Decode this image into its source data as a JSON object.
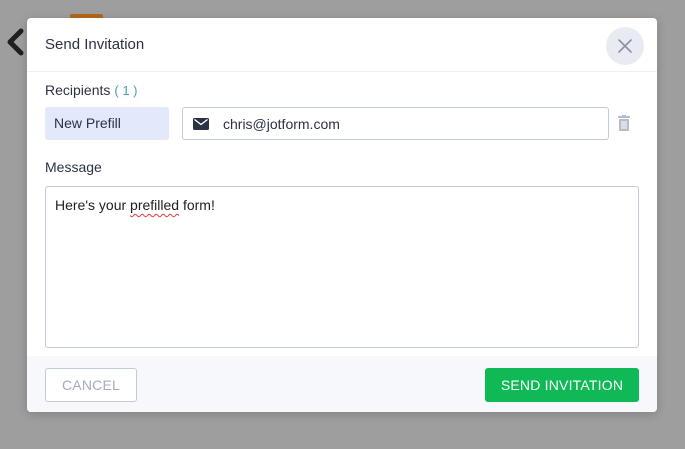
{
  "dialog": {
    "title": "Send Invitation"
  },
  "recipients": {
    "label": "Recipients",
    "count": "( 1 )",
    "items": [
      {
        "name": "New Prefill",
        "email": "chris@jotform.com"
      }
    ]
  },
  "message": {
    "label": "Message",
    "text_before": "Here's your ",
    "misspelled_word": "prefilled",
    "text_after": " form!"
  },
  "footer": {
    "cancel_label": "CANCEL",
    "send_label": "SEND INVITATION"
  },
  "colors": {
    "accent_green": "#0fba56",
    "chip_background": "#e4e8fb",
    "count_color": "#4a9bb5",
    "overlay": "#9e9e9e"
  },
  "icons": {
    "close": "close-icon",
    "mail": "mail-icon",
    "trash": "trash-icon",
    "back": "chevron-left-icon"
  }
}
